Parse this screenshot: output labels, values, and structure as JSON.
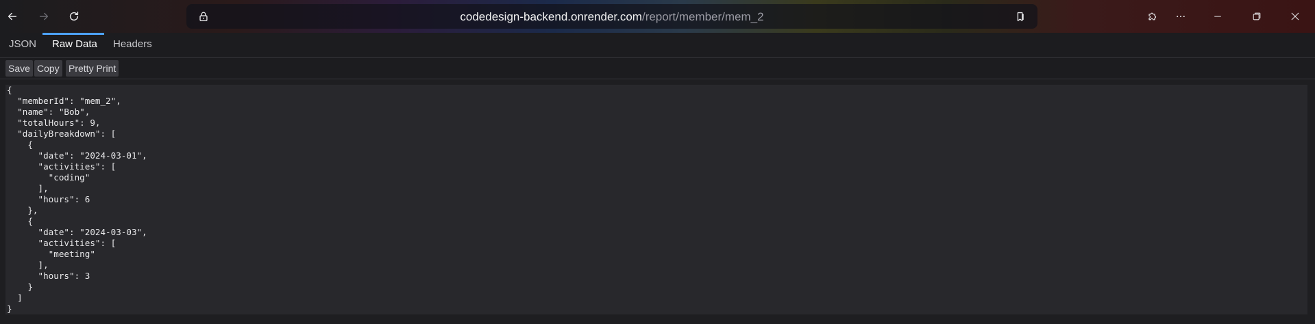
{
  "browser": {
    "url_host": "codedesign-backend.onrender.com",
    "url_path": "/report/member/mem_2",
    "icons": {
      "back": "arrow-left-icon",
      "forward": "arrow-right-icon",
      "refresh": "refresh-icon",
      "lock": "lock-icon",
      "bookmark": "bookmark-icon",
      "extensions": "puzzle-icon",
      "menu": "more-horizontal-icon",
      "minimize": "minimize-icon",
      "restore": "restore-icon",
      "close": "close-icon"
    }
  },
  "viewer": {
    "tabs": [
      {
        "label": "JSON",
        "active": false
      },
      {
        "label": "Raw Data",
        "active": true
      },
      {
        "label": "Headers",
        "active": false
      }
    ],
    "toolbar": {
      "save_label": "Save",
      "copy_label": "Copy",
      "pretty_print_label": "Pretty Print"
    },
    "raw_text": "{\n  \"memberId\": \"mem_2\",\n  \"name\": \"Bob\",\n  \"totalHours\": 9,\n  \"dailyBreakdown\": [\n    {\n      \"date\": \"2024-03-01\",\n      \"activities\": [\n        \"coding\"\n      ],\n      \"hours\": 6\n    },\n    {\n      \"date\": \"2024-03-03\",\n      \"activities\": [\n        \"meeting\"\n      ],\n      \"hours\": 3\n    }\n  ]\n}"
  },
  "colors": {
    "accent": "#4da3ff",
    "background": "#1e1e21",
    "panel": "#28282c"
  }
}
